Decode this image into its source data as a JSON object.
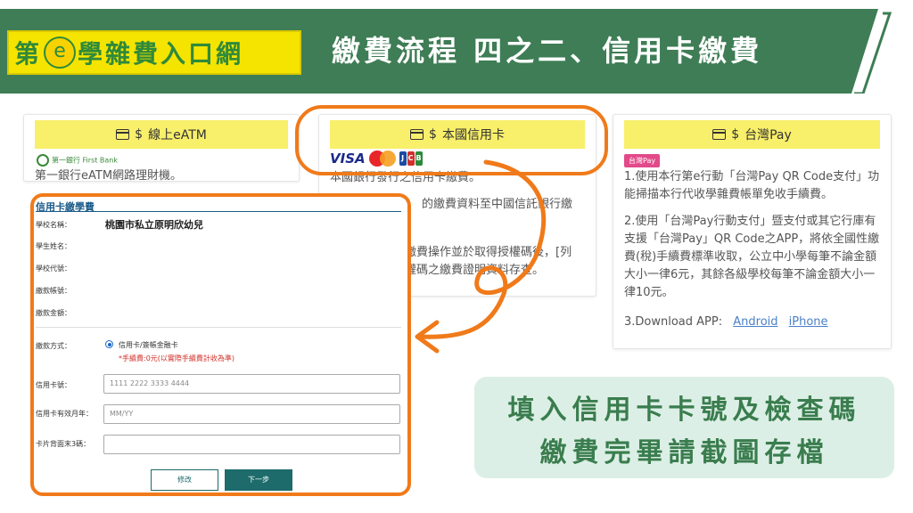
{
  "banner": {
    "logo_prefix": "第",
    "logo_e": "e",
    "logo_suffix": "學雜費入口網",
    "title": "繳費流程 四之二、信用卡繳費",
    "colors": {
      "band": "#3e7d55",
      "logo_bg": "#f5e400"
    }
  },
  "cards": [
    {
      "header": "線上eATM",
      "logo_text": "第一銀行 First Bank",
      "body": "第一銀行eATM網路理財機。"
    },
    {
      "header": "本國信用卡",
      "brands": [
        "VISA",
        "MasterCard",
        "JCB"
      ],
      "body_line1": "本國銀行發行之信用卡繳費。",
      "body_line2_tail": "的繳費資料至中國信託銀行繳",
      "body_line3_tail": "繳費操作並於取得授權碼後，[列",
      "body_line4_tail": "權碼之繳費證明資料存查。"
    },
    {
      "header": "台灣Pay",
      "logo_text": "台灣Pay",
      "p1": "1.使用本行第e行動「台灣Pay QR Code支付」功能掃描本行代收學雜費帳單免收手續費。",
      "p2": "2.使用「台灣Pay行動支付」暨支付或其它行庫有支援「台灣Pay」QR Code之APP，將依全國性繳費(稅)手續費標準收取，公立中小學每筆不論金額大小一律6元，其餘各級學校每筆不論金額大小一律10元。",
      "p3_prefix": "3.Download APP:",
      "links": [
        "Android",
        "iPhone"
      ]
    }
  ],
  "form": {
    "title": "信用卡繳學費",
    "labels": {
      "school_name": "學校名稱：",
      "student_name": "學生姓名：",
      "school_code": "學校代號：",
      "account_no": "繳款帳號：",
      "amount": "繳款金額：",
      "pay_method": "繳款方式：",
      "card_no": "信用卡號：",
      "expiry": "信用卡有效月年：",
      "cvv": "卡片背面末3碼："
    },
    "values": {
      "school_name": "桃園市私立原明欣幼兒"
    },
    "pay_option": "信用卡/簽帳金融卡",
    "fee_note": "*手續費:0元(以實際手續費計收為準)",
    "placeholders": {
      "card_no": "1111 2222 3333 4444",
      "expiry": "MM/YY",
      "cvv": ""
    },
    "buttons": {
      "edit": "修改",
      "next": "下一步"
    }
  },
  "callout": {
    "line1": "填入信用卡卡號及檢查碼",
    "line2": "繳費完畢請截圖存檔"
  },
  "icons": {
    "card_header_icon": "credit-card-icon",
    "arrow": "curved-arrow-icon"
  }
}
